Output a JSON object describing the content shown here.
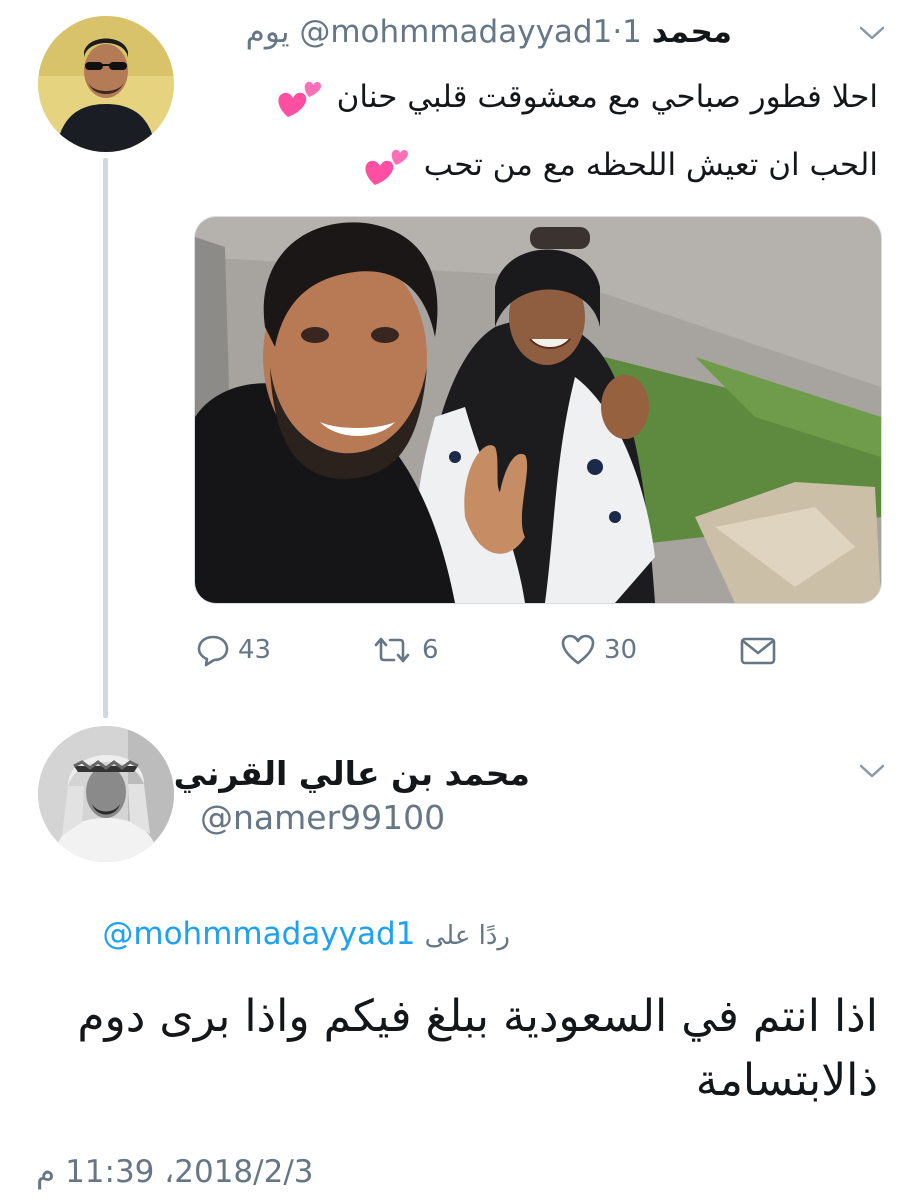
{
  "tweet1": {
    "author_name": "محمد",
    "handle": "@mohmmadayyad1",
    "separator": "·",
    "time": "1 يوم",
    "lines": [
      "احلا فطور صباحي مع معشوقت قلبي حنان",
      "الحب ان تعيش اللحظه مع من تحب"
    ],
    "photo": {
      "description_icon": "photo-selfie"
    },
    "actions": {
      "reply_count": "43",
      "retweet_count": "6",
      "like_count": "30"
    }
  },
  "tweet2": {
    "author_name": "محمد بن عالي القرني",
    "handle": "@namer99100",
    "reply_label": "ردًا على",
    "reply_mention": "@mohmmadayyad1",
    "body": "اذا انتم في السعودية ببلغ فيكم واذا برى دوم ذالابتسامة",
    "timestamp": "2018/2/3، 11:39 م"
  },
  "icons": {
    "reply": "speech-bubble-icon",
    "retweet": "retweet-icon",
    "like": "heart-icon",
    "dm": "envelope-icon",
    "more": "chevron-down-icon",
    "emoji": "two-hearts-emoji"
  },
  "colors": {
    "muted": "#657786",
    "link": "#1da1f2",
    "text": "#14171a",
    "thread_line": "#cfd9de",
    "pink_heart": "#ff4fa3"
  }
}
